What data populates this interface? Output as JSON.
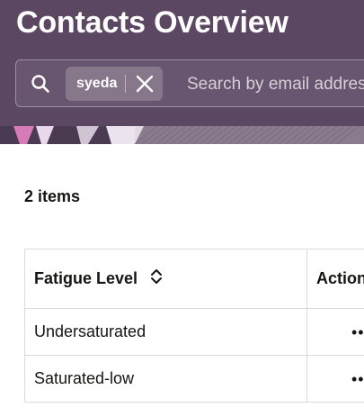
{
  "header": {
    "title": "Contacts Overview",
    "search": {
      "chip_label": "syeda",
      "placeholder": "Search by email address"
    }
  },
  "results": {
    "count_label": "2 items"
  },
  "table": {
    "columns": [
      "Fatigue Level",
      "Actions"
    ],
    "rows": [
      {
        "fatigue_level": "Undersaturated",
        "actions": "•••"
      },
      {
        "fatigue_level": "Saturated-low",
        "actions": "•••"
      }
    ]
  },
  "colors": {
    "header_bg": "#5c4763",
    "text": "#161513",
    "border": "#dcdad7"
  },
  "icons": {
    "search": "search-icon",
    "chip_remove": "close-icon",
    "sort": "sort-icon"
  }
}
